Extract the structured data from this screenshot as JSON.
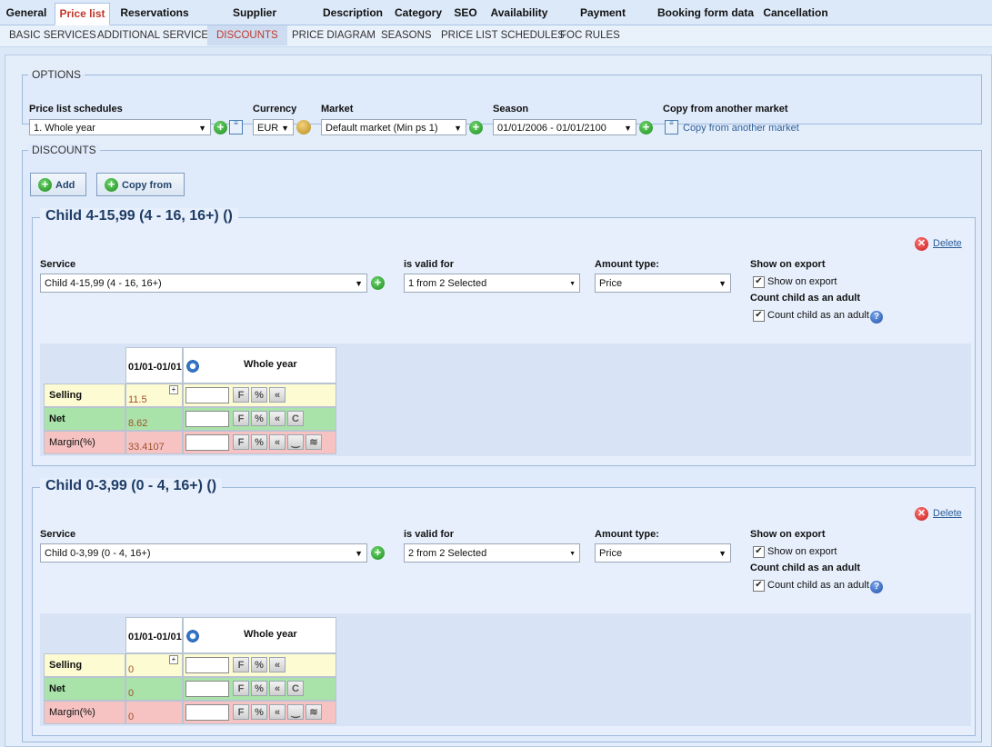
{
  "tabs": [
    "General",
    "Price list",
    "Reservations",
    "Supplier confirmations",
    "Description",
    "Category",
    "SEO",
    "Availability",
    "Payment settings",
    "Booking form data",
    "Cancellation"
  ],
  "subtabs": [
    "BASIC SERVICES",
    "ADDITIONAL SERVICES",
    "DISCOUNTS",
    "PRICE DIAGRAM",
    "SEASONS",
    "PRICE LIST SCHEDULES",
    "FOC RULES"
  ],
  "options": {
    "legend": "OPTIONS",
    "schedules_label": "Price list schedules",
    "schedules_value": "1. Whole year",
    "currency_label": "Currency",
    "currency_value": "EUR",
    "market_label": "Market",
    "market_value": "Default market (Min ps 1)",
    "season_label": "Season",
    "season_value": "01/01/2006 - 01/01/2100",
    "copy_label": "Copy from another market",
    "copy_link": "Copy from another market"
  },
  "discounts": {
    "legend": "DISCOUNTS",
    "add_label": "Add",
    "copy_label": "Copy from",
    "blocks": [
      {
        "title": "Child 4-15,99 (4 - 16, 16+) ()",
        "delete": "Delete",
        "service_label": "Service",
        "service_value": "Child 4-15,99 (4 - 16, 16+)",
        "valid_label": "is valid for",
        "valid_value": "1 from 2 Selected",
        "amount_label": "Amount type:",
        "amount_value": "Price",
        "export_label": "Show on export",
        "export_cb": "Show on export",
        "adult_label": "Count child as an adult",
        "adult_cb": "Count child as an adult",
        "period_header": "01/01-01/01",
        "season_header": "Whole year",
        "rows": [
          {
            "label": "Selling",
            "value": "11.5"
          },
          {
            "label": "Net",
            "value": "8.62"
          },
          {
            "label": "Margin(%)",
            "value": "33.4107"
          }
        ]
      },
      {
        "title": "Child 0-3,99 (0 - 4, 16+) ()",
        "delete": "Delete",
        "service_label": "Service",
        "service_value": "Child 0-3,99 (0 - 4, 16+)",
        "valid_label": "is valid for",
        "valid_value": "2 from 2 Selected",
        "amount_label": "Amount type:",
        "amount_value": "Price",
        "export_label": "Show on export",
        "export_cb": "Show on export",
        "adult_label": "Count child as an adult",
        "adult_cb": "Count child as an adult",
        "period_header": "01/01-01/01",
        "season_header": "Whole year",
        "rows": [
          {
            "label": "Selling",
            "value": "0"
          },
          {
            "label": "Net",
            "value": "0"
          },
          {
            "label": "Margin(%)",
            "value": "0"
          }
        ]
      }
    ]
  },
  "glyphs": {
    "arrow": "▼",
    "plus": "+",
    "check": "✔",
    "help": "?",
    "x": "✕",
    "expand": "+",
    "F": "F",
    "pct": "%",
    "back": "«",
    "C": "C",
    "smile": "‿",
    "dbl": "≋"
  },
  "colors": {
    "selling": "#fdfbd2",
    "net": "#a9e3a9",
    "margin": "#f6c2c2",
    "active_tab_text": "#c0392b"
  }
}
